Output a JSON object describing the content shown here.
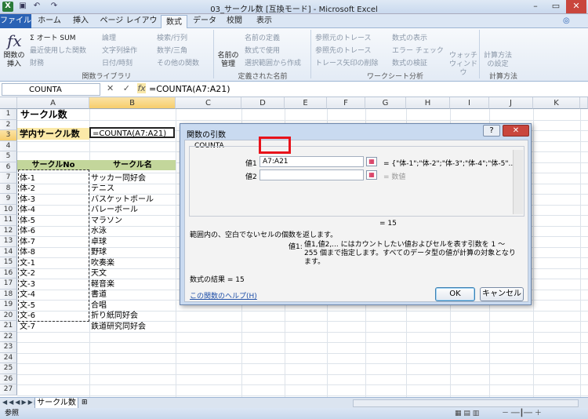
{
  "window": {
    "title": "03_サークル数 [互換モード] - Microsoft Excel"
  },
  "quick_access": {
    "save": "▣",
    "undo": "↶",
    "redo": "↷"
  },
  "tabs": [
    "ファイル",
    "ホーム",
    "挿入",
    "ページ レイアウト",
    "数式",
    "データ",
    "校閲",
    "表示"
  ],
  "ribbon": {
    "insert_function": "関数の挿入",
    "fx_icon": "fx",
    "autosum": "オート SUM",
    "recent": "最近使用した関数",
    "finance": "財務",
    "logic": "論理",
    "text": "文字列操作",
    "datetime": "日付/時刻",
    "lookup": "検索/行列",
    "math": "数学/三角",
    "other": "その他の関数",
    "group_library": "関数ライブラリ",
    "name_manager": "名前の管理",
    "define_name": "名前の定義",
    "use_in_formula": "数式で使用",
    "create_from_sel": "選択範囲から作成",
    "group_names": "定義された名前",
    "trace_precedents": "参照元のトレース",
    "trace_dependents": "参照先のトレース",
    "remove_arrows": "トレース矢印の削除",
    "show_formulas": "数式の表示",
    "error_check": "エラー チェック",
    "evaluate": "数式の検証",
    "watch_window": "ウォッチ ウィンドウ",
    "group_audit": "ワークシート分析",
    "calc_options": "計算方法の設定",
    "group_calc": "計算方法"
  },
  "formula_bar": {
    "name_box": "COUNTA",
    "formula": "=COUNTA(A7:A21)",
    "cancel": "✕",
    "enter": "✓",
    "fx": "fx"
  },
  "columns": [
    "A",
    "B",
    "C",
    "D",
    "E",
    "F",
    "G",
    "H",
    "I",
    "J",
    "K"
  ],
  "rows": [
    "1",
    "2",
    "3",
    "4",
    "5",
    "6",
    "7",
    "8",
    "9",
    "10",
    "11",
    "12",
    "13",
    "14",
    "15",
    "16",
    "17",
    "18",
    "19",
    "20",
    "21",
    "22",
    "23",
    "24",
    "25",
    "26",
    "27"
  ],
  "cells": {
    "title": "サークル数",
    "label": "学内サークル数",
    "formula_cell": "=COUNTA(A7:A21)",
    "header_a": "サークルNo",
    "header_b": "サークル名",
    "col_a": [
      "体-1",
      "体-2",
      "体-3",
      "体-4",
      "体-5",
      "体-6",
      "体-7",
      "体-8",
      "文-1",
      "文-2",
      "文-3",
      "文-4",
      "文-5",
      "文-6",
      "文-7"
    ],
    "col_b": [
      "サッカー同好会",
      "テニス",
      "バスケットボール",
      "バレーボール",
      "マラソン",
      "水泳",
      "卓球",
      "野球",
      "吹奏楽",
      "天文",
      "軽音楽",
      "書道",
      "合唱",
      "折り紙同好会",
      "鉄道研究同好会"
    ]
  },
  "sheet_tabs": {
    "active": "サークル数"
  },
  "status": {
    "mode": "参照"
  },
  "dialog": {
    "title": "関数の引数",
    "help_btn": "?",
    "close_btn": "✕",
    "function_name": "COUNTA",
    "arg1_label": "値1",
    "arg1_value": "A7:A21",
    "arg1_result": "= {\"体-1\";\"体-2\";\"体-3\";\"体-4\";\"体-5\"...",
    "arg2_label": "値2",
    "arg2_value": "",
    "arg2_result": "= 数値",
    "total_result": "= 15",
    "description": "範囲内の、空白でないセルの個数を返します。",
    "arg_desc_label": "値1:",
    "arg_desc": "値1,値2,... にはカウントしたい値およびセルを表す引数を 1 〜 255 個まで指定します。すべてのデータ型の値が計算の対象となります。",
    "formula_result": "数式の結果 =  15",
    "help_link": "この関数のヘルプ(H)",
    "ok": "OK",
    "cancel": "キャンセル"
  }
}
